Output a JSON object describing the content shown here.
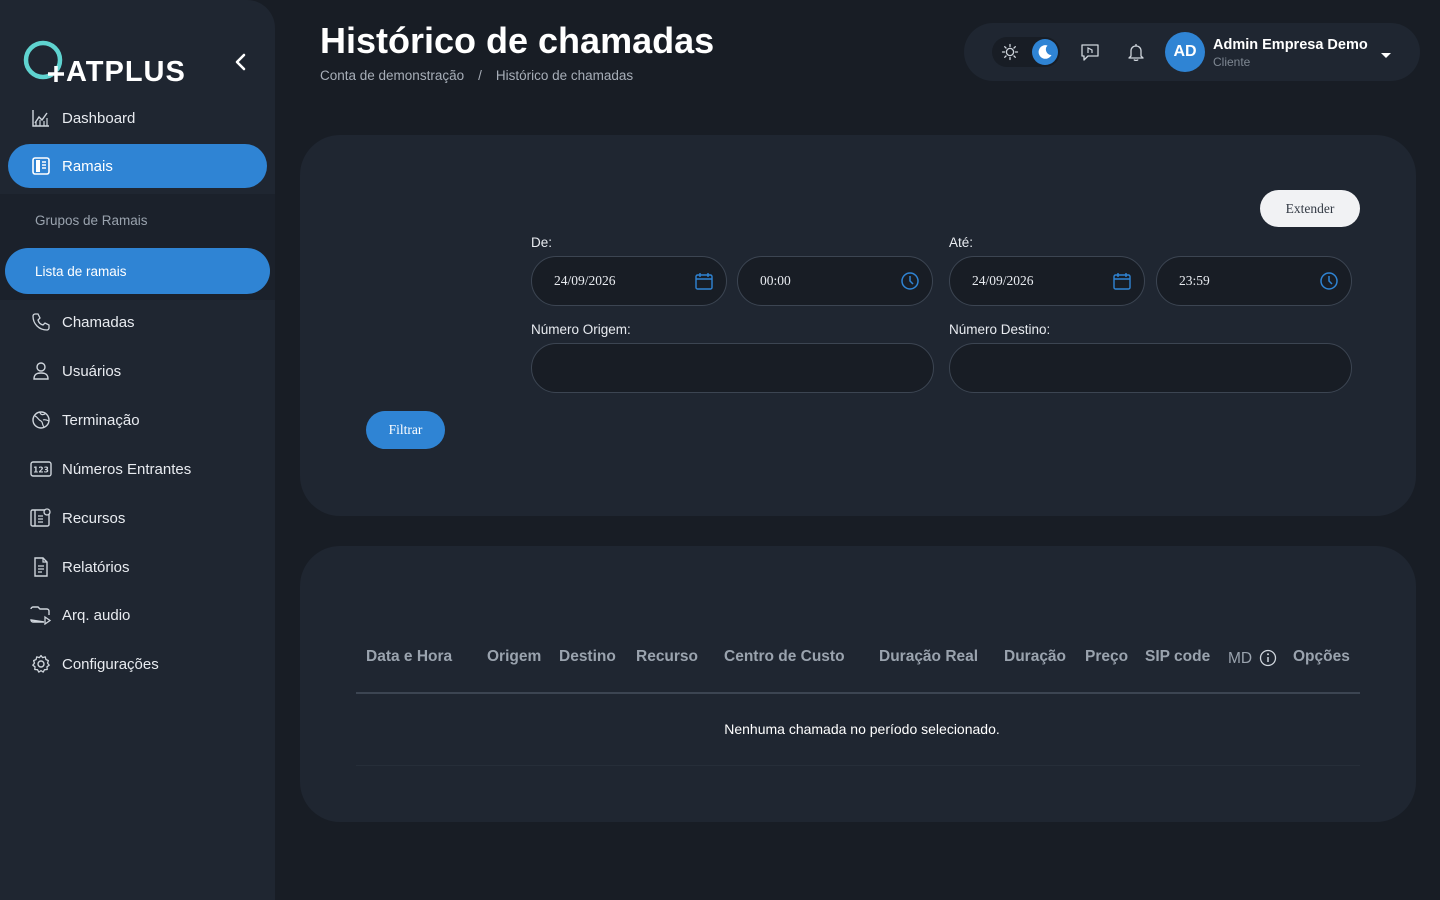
{
  "app": {
    "logo_text": "ATPLUS"
  },
  "sidebar": {
    "items": [
      {
        "label": "Dashboard",
        "icon": "chart-icon"
      },
      {
        "label": "Ramais",
        "icon": "phonebook-icon",
        "active": true
      },
      {
        "label": "Chamadas",
        "icon": "phone-icon"
      },
      {
        "label": "Usuários",
        "icon": "user-icon"
      },
      {
        "label": "Terminação",
        "icon": "globe-icon"
      },
      {
        "label": "Números Entrantes",
        "icon": "numbers-123-icon"
      },
      {
        "label": "Recursos",
        "icon": "resources-icon"
      },
      {
        "label": "Relatórios",
        "icon": "document-icon"
      },
      {
        "label": "Arq. audio",
        "icon": "audio-folder-icon"
      },
      {
        "label": "Configurações",
        "icon": "gear-icon"
      }
    ],
    "submenu": [
      {
        "label": "Grupos de Ramais"
      },
      {
        "label": "Lista de ramais",
        "active": true
      }
    ]
  },
  "header": {
    "title": "Histórico de chamadas",
    "breadcrumb": [
      "Conta de demonstração",
      "/",
      "Histórico de chamadas"
    ]
  },
  "user": {
    "initials": "AD",
    "name": "Admin Empresa Demo",
    "role": "Cliente"
  },
  "filters": {
    "extend_label": "Extender",
    "from_label": "De:",
    "to_label": "Até:",
    "from_date": "24/09/2026",
    "from_time": "00:00",
    "to_date": "24/09/2026",
    "to_time": "23:59",
    "origin_label": "Número Origem:",
    "origin_value": "",
    "destination_label": "Número Destino:",
    "destination_value": "",
    "filter_label": "Filtrar"
  },
  "table": {
    "columns": [
      "Data e Hora",
      "Origem",
      "Destino",
      "Recurso",
      "Centro de Custo",
      "Duração Real",
      "Duração",
      "Preço",
      "SIP code",
      "MD",
      "Opções"
    ],
    "empty_message": "Nenhuma chamada no período selecionado."
  },
  "colors": {
    "accent": "#2f84d4",
    "background": "#181d25",
    "card": "#1f2631"
  }
}
